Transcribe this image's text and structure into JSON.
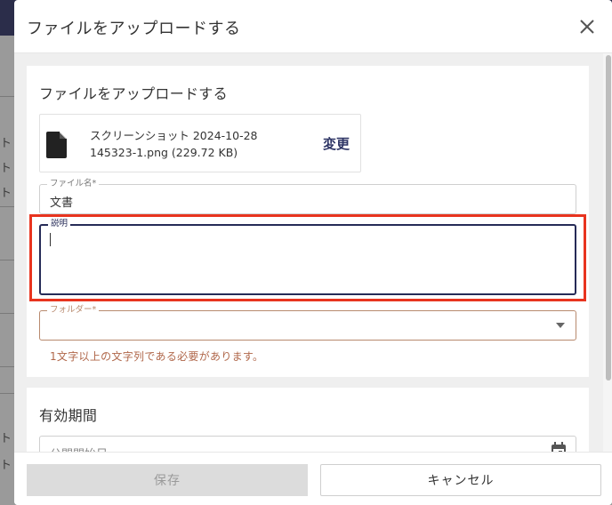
{
  "dialog": {
    "title": "ファイルをアップロードする"
  },
  "upload_section": {
    "heading": "ファイルをアップロードする",
    "file": {
      "icon": "file-icon",
      "name": "スクリーンショット 2024-10-28 145323-1.png (229.72 KB)",
      "change_label": "変更"
    },
    "filename_field": {
      "label": "ファイル名*",
      "value": "文書"
    },
    "description_field": {
      "label": "説明",
      "value": ""
    },
    "folder_field": {
      "label": "フォルダー*",
      "value": ""
    },
    "folder_error": "1文字以上の文字列である必要があります。"
  },
  "period_section": {
    "heading": "有効期間",
    "start_field": {
      "label": "",
      "placeholder": "公開開始日"
    }
  },
  "footer": {
    "save_label": "保存",
    "cancel_label": "キャンセル"
  },
  "backdrop": {
    "glyphs": [
      "ト",
      "ト",
      "ト",
      "ト",
      "ト"
    ]
  },
  "colors": {
    "highlight": "#e8341f",
    "accent": "#262b57",
    "error": "#b0674a"
  }
}
